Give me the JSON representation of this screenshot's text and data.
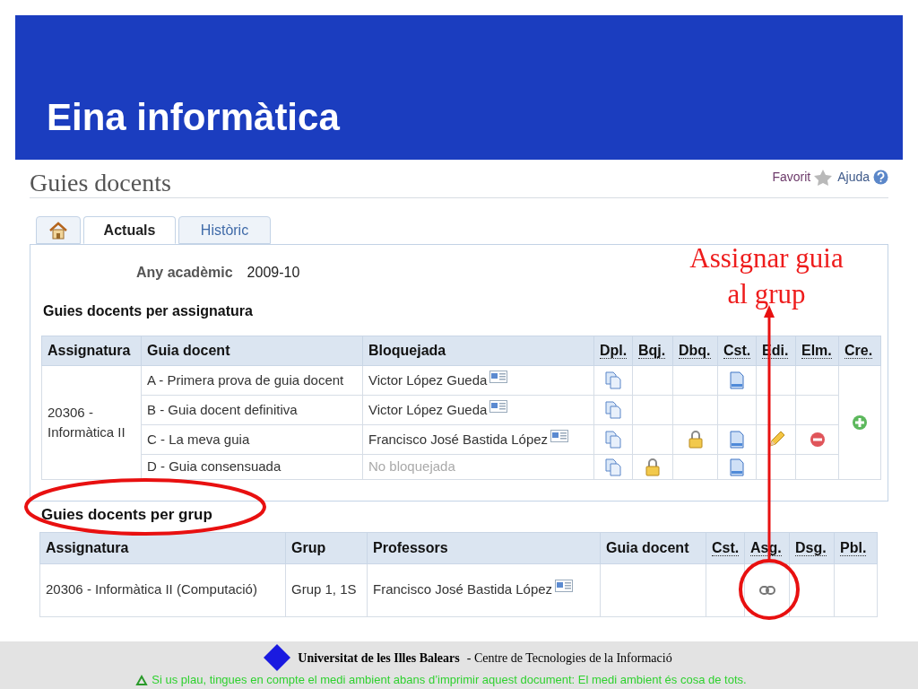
{
  "slide": {
    "title": "Eina informàtica"
  },
  "page": {
    "title": "Guies docents",
    "links": [
      {
        "label": "Favorit",
        "kind": "favorite"
      },
      {
        "label": "Ajuda",
        "kind": "help"
      }
    ]
  },
  "tabs": [
    {
      "kind": "home",
      "selected": false
    },
    {
      "kind": "text",
      "label": "Actuals",
      "selected": true
    },
    {
      "kind": "text",
      "label": "Històric",
      "selected": false
    }
  ],
  "year": {
    "label": "Any acadèmic",
    "value": "2009-10"
  },
  "annotation": {
    "lines": [
      "Assignar guia",
      "al grup"
    ]
  },
  "table1": {
    "title": "Guies docents per assignatura",
    "columns": [
      "Assignatura",
      "Guia docent",
      "Bloquejada",
      "Dpl.",
      "Bqj.",
      "Dbq.",
      "Cst.",
      "Edi.",
      "Elm.",
      "Cre."
    ],
    "subject": "20306 - Informàtica II",
    "create": {
      "kind": "add"
    },
    "rows": [
      {
        "guide": "A - Primera prova de guia docent",
        "locked": true,
        "locked_by": "Victor López Gueda",
        "actions": [
          {
            "kind": "copy"
          },
          {
            "kind": "empty"
          },
          {
            "kind": "empty"
          },
          {
            "kind": "doc"
          },
          {
            "kind": "empty"
          },
          {
            "kind": "empty"
          }
        ]
      },
      {
        "guide": "B - Guia docent definitiva",
        "locked": true,
        "locked_by": "Victor López Gueda",
        "actions": [
          {
            "kind": "copy"
          },
          {
            "kind": "empty"
          },
          {
            "kind": "empty"
          },
          {
            "kind": "empty"
          },
          {
            "kind": "empty"
          },
          {
            "kind": "empty"
          }
        ]
      },
      {
        "guide": "C - La meva guia",
        "locked": true,
        "locked_by": "Francisco José Bastida López",
        "actions": [
          {
            "kind": "copy"
          },
          {
            "kind": "empty"
          },
          {
            "kind": "lock"
          },
          {
            "kind": "doc"
          },
          {
            "kind": "pencil"
          },
          {
            "kind": "remove"
          }
        ]
      },
      {
        "guide": "D - Guia consensuada",
        "locked": false,
        "locked_by": "No bloquejada",
        "actions": [
          {
            "kind": "copy"
          },
          {
            "kind": "lock"
          },
          {
            "kind": "empty"
          },
          {
            "kind": "doc"
          },
          {
            "kind": "empty"
          },
          {
            "kind": "empty"
          }
        ]
      }
    ]
  },
  "table2": {
    "title": "Guies docents per grup",
    "columns": [
      "Assignatura",
      "Grup",
      "Professors",
      "Guia docent",
      "Cst.",
      "Asg.",
      "Dsg.",
      "Pbl."
    ],
    "rows": [
      {
        "subject": "20306 - Informàtica II (Computació)",
        "group": "Grup 1, 1S",
        "professor": "Francisco José Bastida López",
        "actions": [
          {
            "kind": "empty"
          },
          {
            "kind": "link"
          },
          {
            "kind": "empty"
          },
          {
            "kind": "empty"
          }
        ]
      }
    ]
  },
  "footer": {
    "university": "Universitat de les Illes Balears",
    "centre": "- Centre de Tecnologies de la Informació",
    "note": "Si us plau, tingues en compte el medi ambient abans d’imprimir aquest document: El medi ambient és cosa de tots."
  }
}
